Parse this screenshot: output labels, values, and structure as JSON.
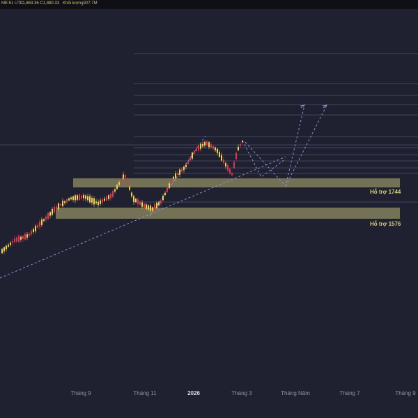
{
  "header": {
    "left": "ME:51 UTC",
    "price": "L1,863.36  C1,880.33",
    "volume": "Khối lượng927.7M"
  },
  "x_axis": {
    "labels": [
      "Tháng 9",
      "Tháng 11",
      "2026",
      "Tháng 3",
      "Tháng Năm",
      "Tháng 7",
      "Tháng 9"
    ],
    "bold_index": 2
  },
  "support_zones": [
    {
      "label": "Hỗ trợ 1744"
    },
    {
      "label": "Hỗ trợ 1576"
    }
  ],
  "colors": {
    "background": "#1f2030",
    "bullish": "#f2d24a",
    "bearish": "#e0364f",
    "zone": "#8a8760",
    "trendline": "#8c8fd6",
    "grid": "#41435a"
  }
}
